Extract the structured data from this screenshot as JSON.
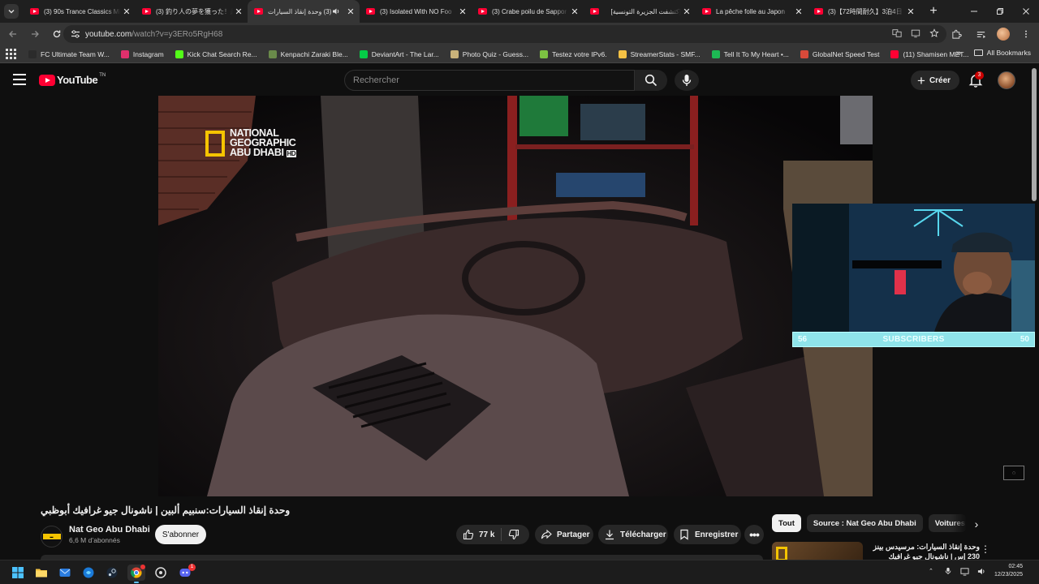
{
  "browser": {
    "tabs": [
      {
        "title": "(3) 90s Trance Classics Mi",
        "active": false
      },
      {
        "title": "(3) 釣り人の夢を獲った！超",
        "active": false
      },
      {
        "title": "(3) وحدة إنقاذ السيارات",
        "active": true,
        "audio": true
      },
      {
        "title": "(3) Isolated With NO Foo",
        "active": false
      },
      {
        "title": "(3) Crabe poilu de Sappor",
        "active": false
      },
      {
        "title": "[كتشفت الجزيرة التونسية]",
        "active": false
      },
      {
        "title": "La pêche folle au Japon",
        "active": false
      },
      {
        "title": "(3)【72時間耐久】3泊4日",
        "active": false
      }
    ],
    "url": {
      "host": "youtube.com",
      "path": "/watch?v=y3ERo5RgH68"
    },
    "bookmarks": [
      {
        "label": "FC Ultimate Team W...",
        "color": "#2b2b2b"
      },
      {
        "label": "Instagram",
        "color": "#e1306c"
      },
      {
        "label": "Kick Chat Search Re...",
        "color": "#53fc18"
      },
      {
        "label": "Kenpachi Zaraki Ble...",
        "color": "#6a8a4a"
      },
      {
        "label": "DeviantArt - The Lar...",
        "color": "#05cc47"
      },
      {
        "label": "Photo Quiz - Guess...",
        "color": "#c9b27a"
      },
      {
        "label": "Testez votre IPv6.",
        "color": "#7cc242"
      },
      {
        "label": "StreamerStats - SMF...",
        "color": "#f6c244"
      },
      {
        "label": "Tell It To My Heart •...",
        "color": "#1db954"
      },
      {
        "label": "GlobalNet Speed Test",
        "color": "#d84a3a"
      },
      {
        "label": "(11) Shamisen MET...",
        "color": "#ff0033"
      }
    ],
    "more_label": "»",
    "all_bookmarks_label": "All Bookmarks"
  },
  "youtube": {
    "logo_text": "YouTube",
    "logo_sup": "TN",
    "search_placeholder": "Rechercher",
    "create_label": "Créer",
    "notification_count": "3",
    "video": {
      "title": "وحدة إنقاذ السيارات:سنبيم ألبين | ناشونال جيو غرافيك أبوظبي",
      "channel_logo_lines": [
        "NATIONAL",
        "GEOGRAPHIC",
        "ABU DHABI"
      ],
      "channel_logo_badge": "HD"
    },
    "overlay": {
      "sub_left": "56",
      "sub_label": "SUBSCRIBERS",
      "sub_right": "50"
    },
    "channel": {
      "name": "Nat Geo Abu Dhabi",
      "subscribers": "6,6 M d’abonnés",
      "subscribe_label": "S'abonner"
    },
    "actions": {
      "likes": "77 k",
      "share": "Partager",
      "download": "Télécharger",
      "save": "Enregistrer",
      "more": "•••"
    },
    "chips": [
      "Tout",
      "Source : Nat Geo Abu Dhabi",
      "Voitures vin"
    ],
    "recommendation": {
      "title": "وحدة إنقاذ السيارات: مرسيدس بينز 230 إس | ناشونال جيو غرافيك أبوظبي"
    }
  },
  "taskbar": {
    "clock_time": "02:45",
    "clock_date": "12/23/2025",
    "discord_badge": "1"
  }
}
